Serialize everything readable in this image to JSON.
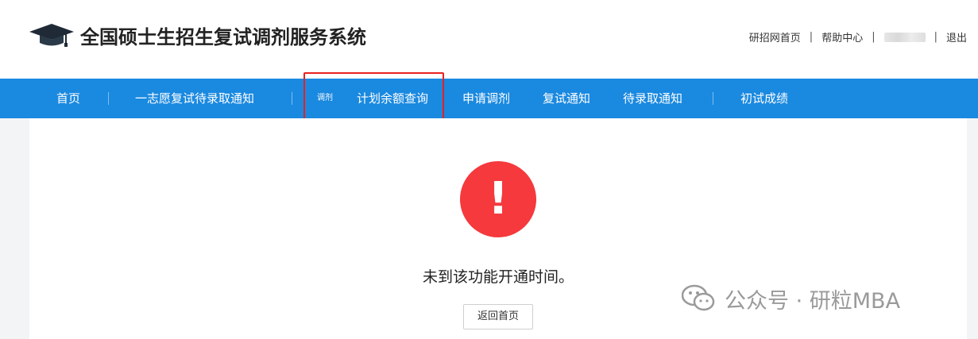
{
  "header": {
    "site_title": "全国硕士生招生复试调剂服务系统",
    "logo_icon": "graduation-cap-icon",
    "top_links": {
      "home": "研招网首页",
      "help": "帮助中心",
      "separator": "|",
      "logout": "退出"
    }
  },
  "nav": {
    "items": [
      {
        "label": "首页"
      },
      {
        "label": "一志愿复试待录取通知"
      },
      {
        "label": "计划余额查询",
        "badge": "调剂"
      },
      {
        "label": "申请调剂"
      },
      {
        "label": "复试通知"
      },
      {
        "label": "待录取通知"
      },
      {
        "label": "初试成绩"
      }
    ],
    "separator": "|",
    "background_color": "#1a89e0"
  },
  "main": {
    "alert_icon": "exclamation-icon",
    "alert_mark": "!",
    "alert_color": "#f5393d",
    "message": "未到该功能开通时间。",
    "back_button": "返回首页"
  },
  "watermark": {
    "icon": "wechat-icon",
    "text": "公众号 · 研粒MBA"
  },
  "highlight_color": "#e8211f"
}
